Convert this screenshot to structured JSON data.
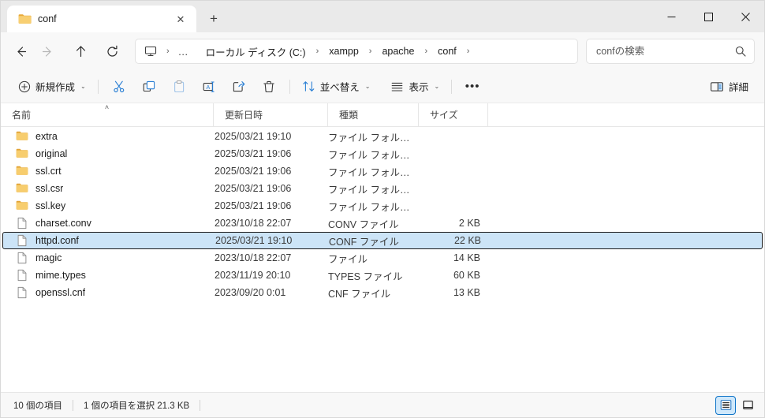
{
  "window": {
    "tab_title": "conf",
    "tab_icon": "folder-icon",
    "close_tab_label": "✕",
    "new_tab_label": "+",
    "minimize_label": "─",
    "maximize_label": "☐",
    "close_label": "✕"
  },
  "nav": {
    "back": "←",
    "forward": "→",
    "up": "↑",
    "refresh": "⟳"
  },
  "breadcrumb": {
    "pc_icon": "this-pc-icon",
    "ellipsis": "…",
    "items": [
      {
        "label": "ローカル ディスク (C:)"
      },
      {
        "label": "xampp"
      },
      {
        "label": "apache"
      },
      {
        "label": "conf"
      }
    ],
    "separator": "›"
  },
  "search": {
    "placeholder": "confの検索",
    "value": "",
    "icon": "search-icon"
  },
  "commandbar": {
    "new_label": "新規作成",
    "cut_label": "切り取り",
    "copy_label": "コピー",
    "paste_label": "貼り付け",
    "rename_label": "名前の変更",
    "share_label": "共有",
    "delete_label": "削除",
    "sort_label": "並べ替え",
    "view_label": "表示",
    "more_label": "•••",
    "details_label": "詳細",
    "chevron": "⌄"
  },
  "columns": {
    "name": "名前",
    "date": "更新日時",
    "type": "種類",
    "size": "サイズ",
    "sort_caret": "˄"
  },
  "files": [
    {
      "name": "extra",
      "date": "2025/03/21 19:10",
      "type": "ファイル フォルダー",
      "size": "",
      "icon": "folder-icon",
      "selected": false
    },
    {
      "name": "original",
      "date": "2025/03/21 19:06",
      "type": "ファイル フォルダー",
      "size": "",
      "icon": "folder-icon",
      "selected": false
    },
    {
      "name": "ssl.crt",
      "date": "2025/03/21 19:06",
      "type": "ファイル フォルダー",
      "size": "",
      "icon": "folder-icon",
      "selected": false
    },
    {
      "name": "ssl.csr",
      "date": "2025/03/21 19:06",
      "type": "ファイル フォルダー",
      "size": "",
      "icon": "folder-icon",
      "selected": false
    },
    {
      "name": "ssl.key",
      "date": "2025/03/21 19:06",
      "type": "ファイル フォルダー",
      "size": "",
      "icon": "folder-icon",
      "selected": false
    },
    {
      "name": "charset.conv",
      "date": "2023/10/18 22:07",
      "type": "CONV ファイル",
      "size": "2 KB",
      "icon": "file-icon",
      "selected": false
    },
    {
      "name": "httpd.conf",
      "date": "2025/03/21 19:10",
      "type": "CONF ファイル",
      "size": "22 KB",
      "icon": "file-icon",
      "selected": true
    },
    {
      "name": "magic",
      "date": "2023/10/18 22:07",
      "type": "ファイル",
      "size": "14 KB",
      "icon": "file-icon",
      "selected": false
    },
    {
      "name": "mime.types",
      "date": "2023/11/19 20:10",
      "type": "TYPES ファイル",
      "size": "60 KB",
      "icon": "file-icon",
      "selected": false
    },
    {
      "name": "openssl.cnf",
      "date": "2023/09/20 0:01",
      "type": "CNF ファイル",
      "size": "13 KB",
      "icon": "file-icon",
      "selected": false
    }
  ],
  "statusbar": {
    "item_count": "10 個の項目",
    "selection": "1 個の項目を選択  21.3 KB",
    "details_view": "details-view-icon",
    "large_icons_view": "large-icons-view-icon"
  },
  "colors": {
    "accent": "#0f74c8",
    "selection_bg": "#cce4f7",
    "folder": "#f6d17a",
    "toolbar_icon_blue": "#2a7fd4"
  }
}
